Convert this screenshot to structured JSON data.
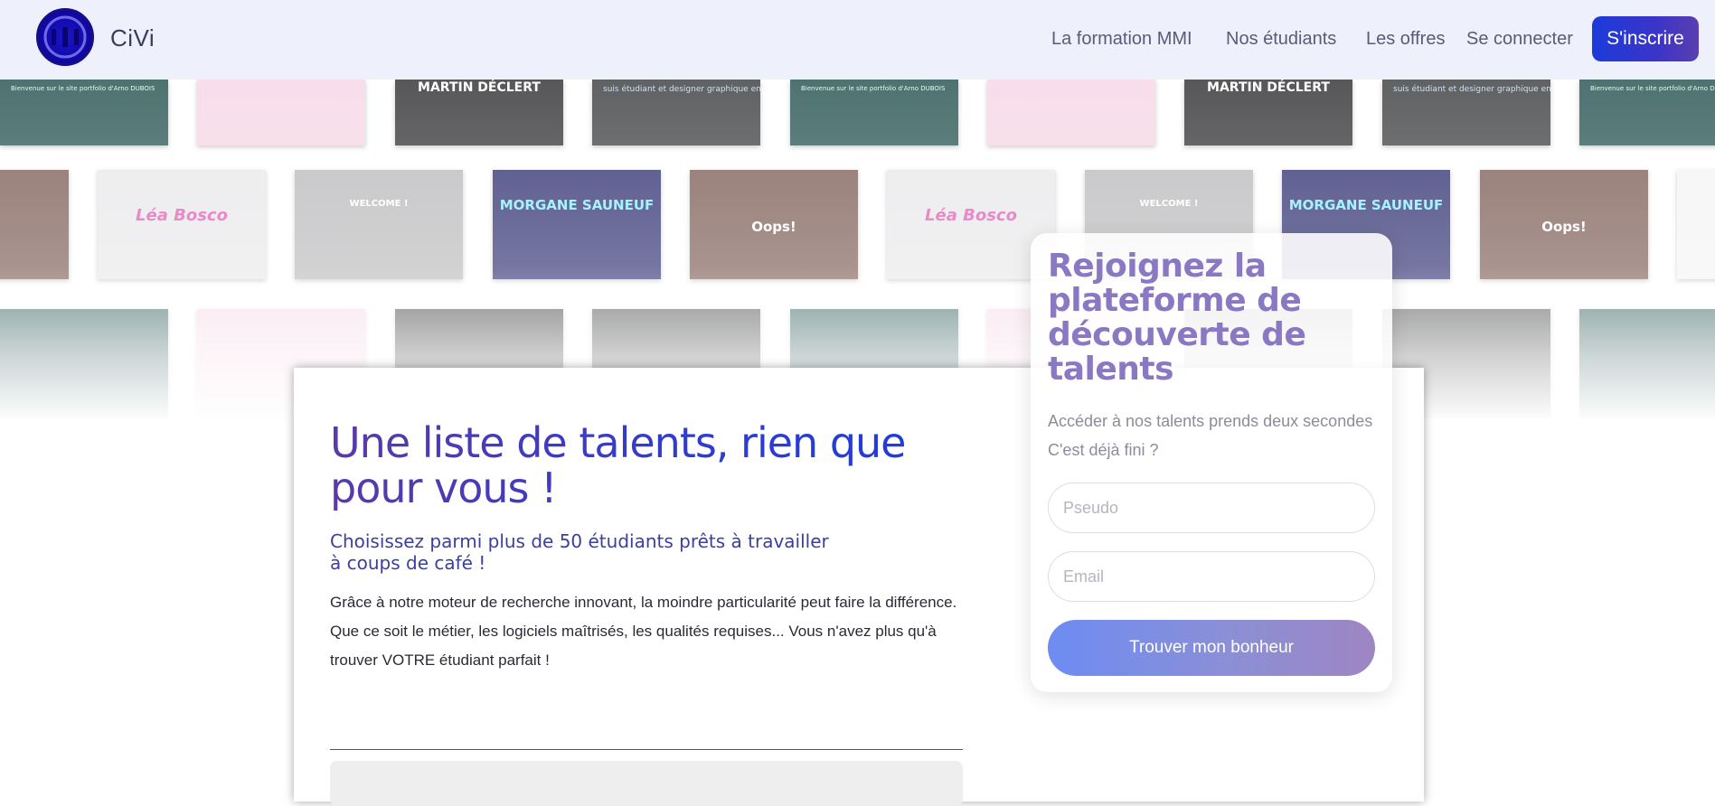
{
  "header": {
    "brand": "CiVi",
    "nav": [
      {
        "label": "La formation MMI"
      },
      {
        "label": "Nos étudiants"
      },
      {
        "label": "Les offres"
      },
      {
        "label": "Se connecter"
      }
    ],
    "signup_label": "S'inscrire",
    "logo_icon": "civi-logo-icon"
  },
  "portfolio_strip": {
    "thumbs": [
      {
        "theme": "teal",
        "text": "Bienvenue sur le site portfolio d'Arno DUBOIS"
      },
      {
        "theme": "pink",
        "text": ""
      },
      {
        "theme": "dark",
        "text": "MARTIN DÉCLERT"
      },
      {
        "theme": "gray",
        "text": "suis étudiant et designer graphique en freelance"
      },
      {
        "theme": "light",
        "text": "Léa Bosco"
      },
      {
        "theme": "welcome",
        "text": "WELCOME !"
      },
      {
        "theme": "neon",
        "text": "MORGANE SAUNEUF"
      },
      {
        "theme": "eye",
        "text": "Oops!"
      },
      {
        "theme": "white",
        "text": ""
      }
    ]
  },
  "main_card": {
    "headline": "Une liste de talents, rien que pour vous !",
    "subhead": "Choisissez parmi plus de 50 étudiants prêts à travailler à coups de café !",
    "body": "Grâce à notre moteur de recherche innovant, la moindre particularité peut faire la différence. Que ce soit le métier, les logiciels maîtrisés, les qualités requises... Vous n'avez plus qu'à trouver VOTRE étudiant parfait !"
  },
  "signup_card": {
    "title": "Rejoignez la plateforme de découverte de talents",
    "desc_line1": "Accéder à nos talents prends deux secondes",
    "desc_line2": "C'est déjà fini ?",
    "pseudo_placeholder": "Pseudo",
    "email_placeholder": "Email",
    "cta_label": "Trouver mon bonheur"
  },
  "colors": {
    "header_bg": "#eef0fb",
    "brand_blue": "#1d3be0",
    "brand_purple": "#5a3aa8",
    "cta_gradient_start": "#6d8cf2",
    "cta_gradient_end": "#9e86c2"
  }
}
